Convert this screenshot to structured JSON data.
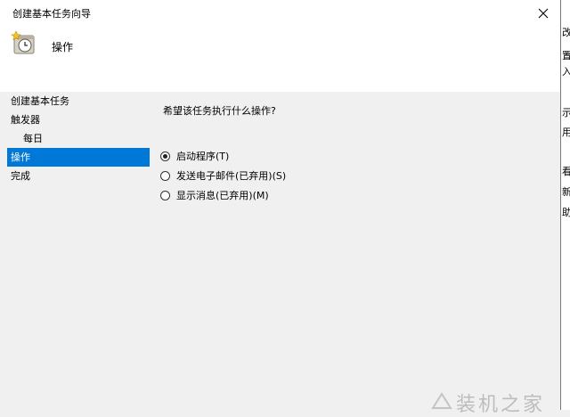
{
  "window": {
    "title": "创建基本任务向导"
  },
  "header": {
    "title": "操作"
  },
  "steps": [
    {
      "label": "创建基本任务"
    },
    {
      "label": "触发器"
    },
    {
      "label": "每日"
    },
    {
      "label": "操作"
    },
    {
      "label": "完成"
    }
  ],
  "main": {
    "question": "希望该任务执行什么操作?",
    "options": [
      {
        "label": "启动程序(T)",
        "checked": true
      },
      {
        "label": "发送电子邮件(已弃用)(S)",
        "checked": false
      },
      {
        "label": "显示消息(已弃用)(M)",
        "checked": false
      }
    ]
  },
  "background_window": {
    "edge_text": [
      "改",
      "置",
      "入",
      "示",
      "用",
      "看",
      "新",
      "助"
    ]
  },
  "watermark": {
    "text": "装机之家"
  },
  "colors": {
    "selection": "#0078d7",
    "dialog_bg": "#f0f0f0",
    "header_bg": "#ffffff"
  }
}
